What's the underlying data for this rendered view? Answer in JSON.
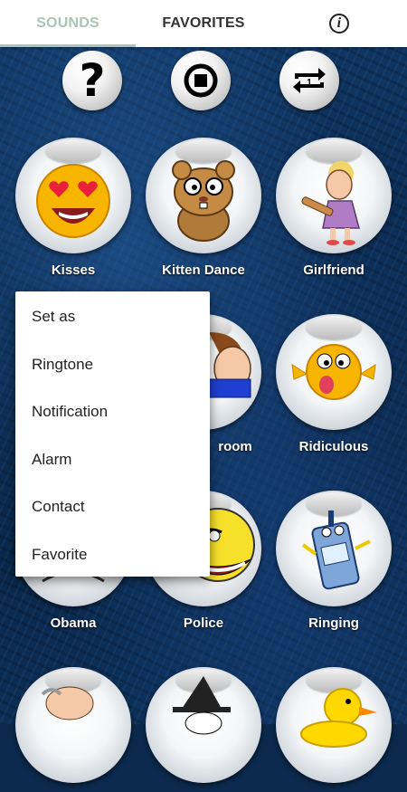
{
  "tabs": [
    {
      "label": "SOUNDS",
      "active": true
    },
    {
      "label": "FAVORITES",
      "active": false
    }
  ],
  "info_icon": {
    "icon": "info-icon",
    "glyph": "i"
  },
  "controls": [
    {
      "icon": "help-icon",
      "glyph": "?"
    },
    {
      "icon": "stop-icon"
    },
    {
      "icon": "repeat-one-icon"
    }
  ],
  "sounds": [
    {
      "label": "Kisses",
      "icon": "heart-eyes-emoji"
    },
    {
      "label": "Kitten Dance",
      "icon": "hamster-cartoon"
    },
    {
      "label": "Girlfriend",
      "icon": "angry-woman-rolling-pin"
    },
    {
      "label": "room",
      "icon": "cartoon-boy"
    },
    {
      "label": "Ridiculous",
      "icon": "tongue-out-emoji"
    },
    {
      "label": "Obama",
      "icon": "cartoon-face"
    },
    {
      "label": "Police",
      "icon": "troll-face"
    },
    {
      "label": "Ringing",
      "icon": "cartoon-phone"
    },
    {
      "label": "",
      "icon": "old-man-cartoon"
    },
    {
      "label": "",
      "icon": "witch-cartoon"
    },
    {
      "label": "",
      "icon": "rubber-duck"
    }
  ],
  "menu": {
    "items": [
      "Set as",
      "Ringtone",
      "Notification",
      "Alarm",
      "Contact",
      "Favorite"
    ]
  }
}
